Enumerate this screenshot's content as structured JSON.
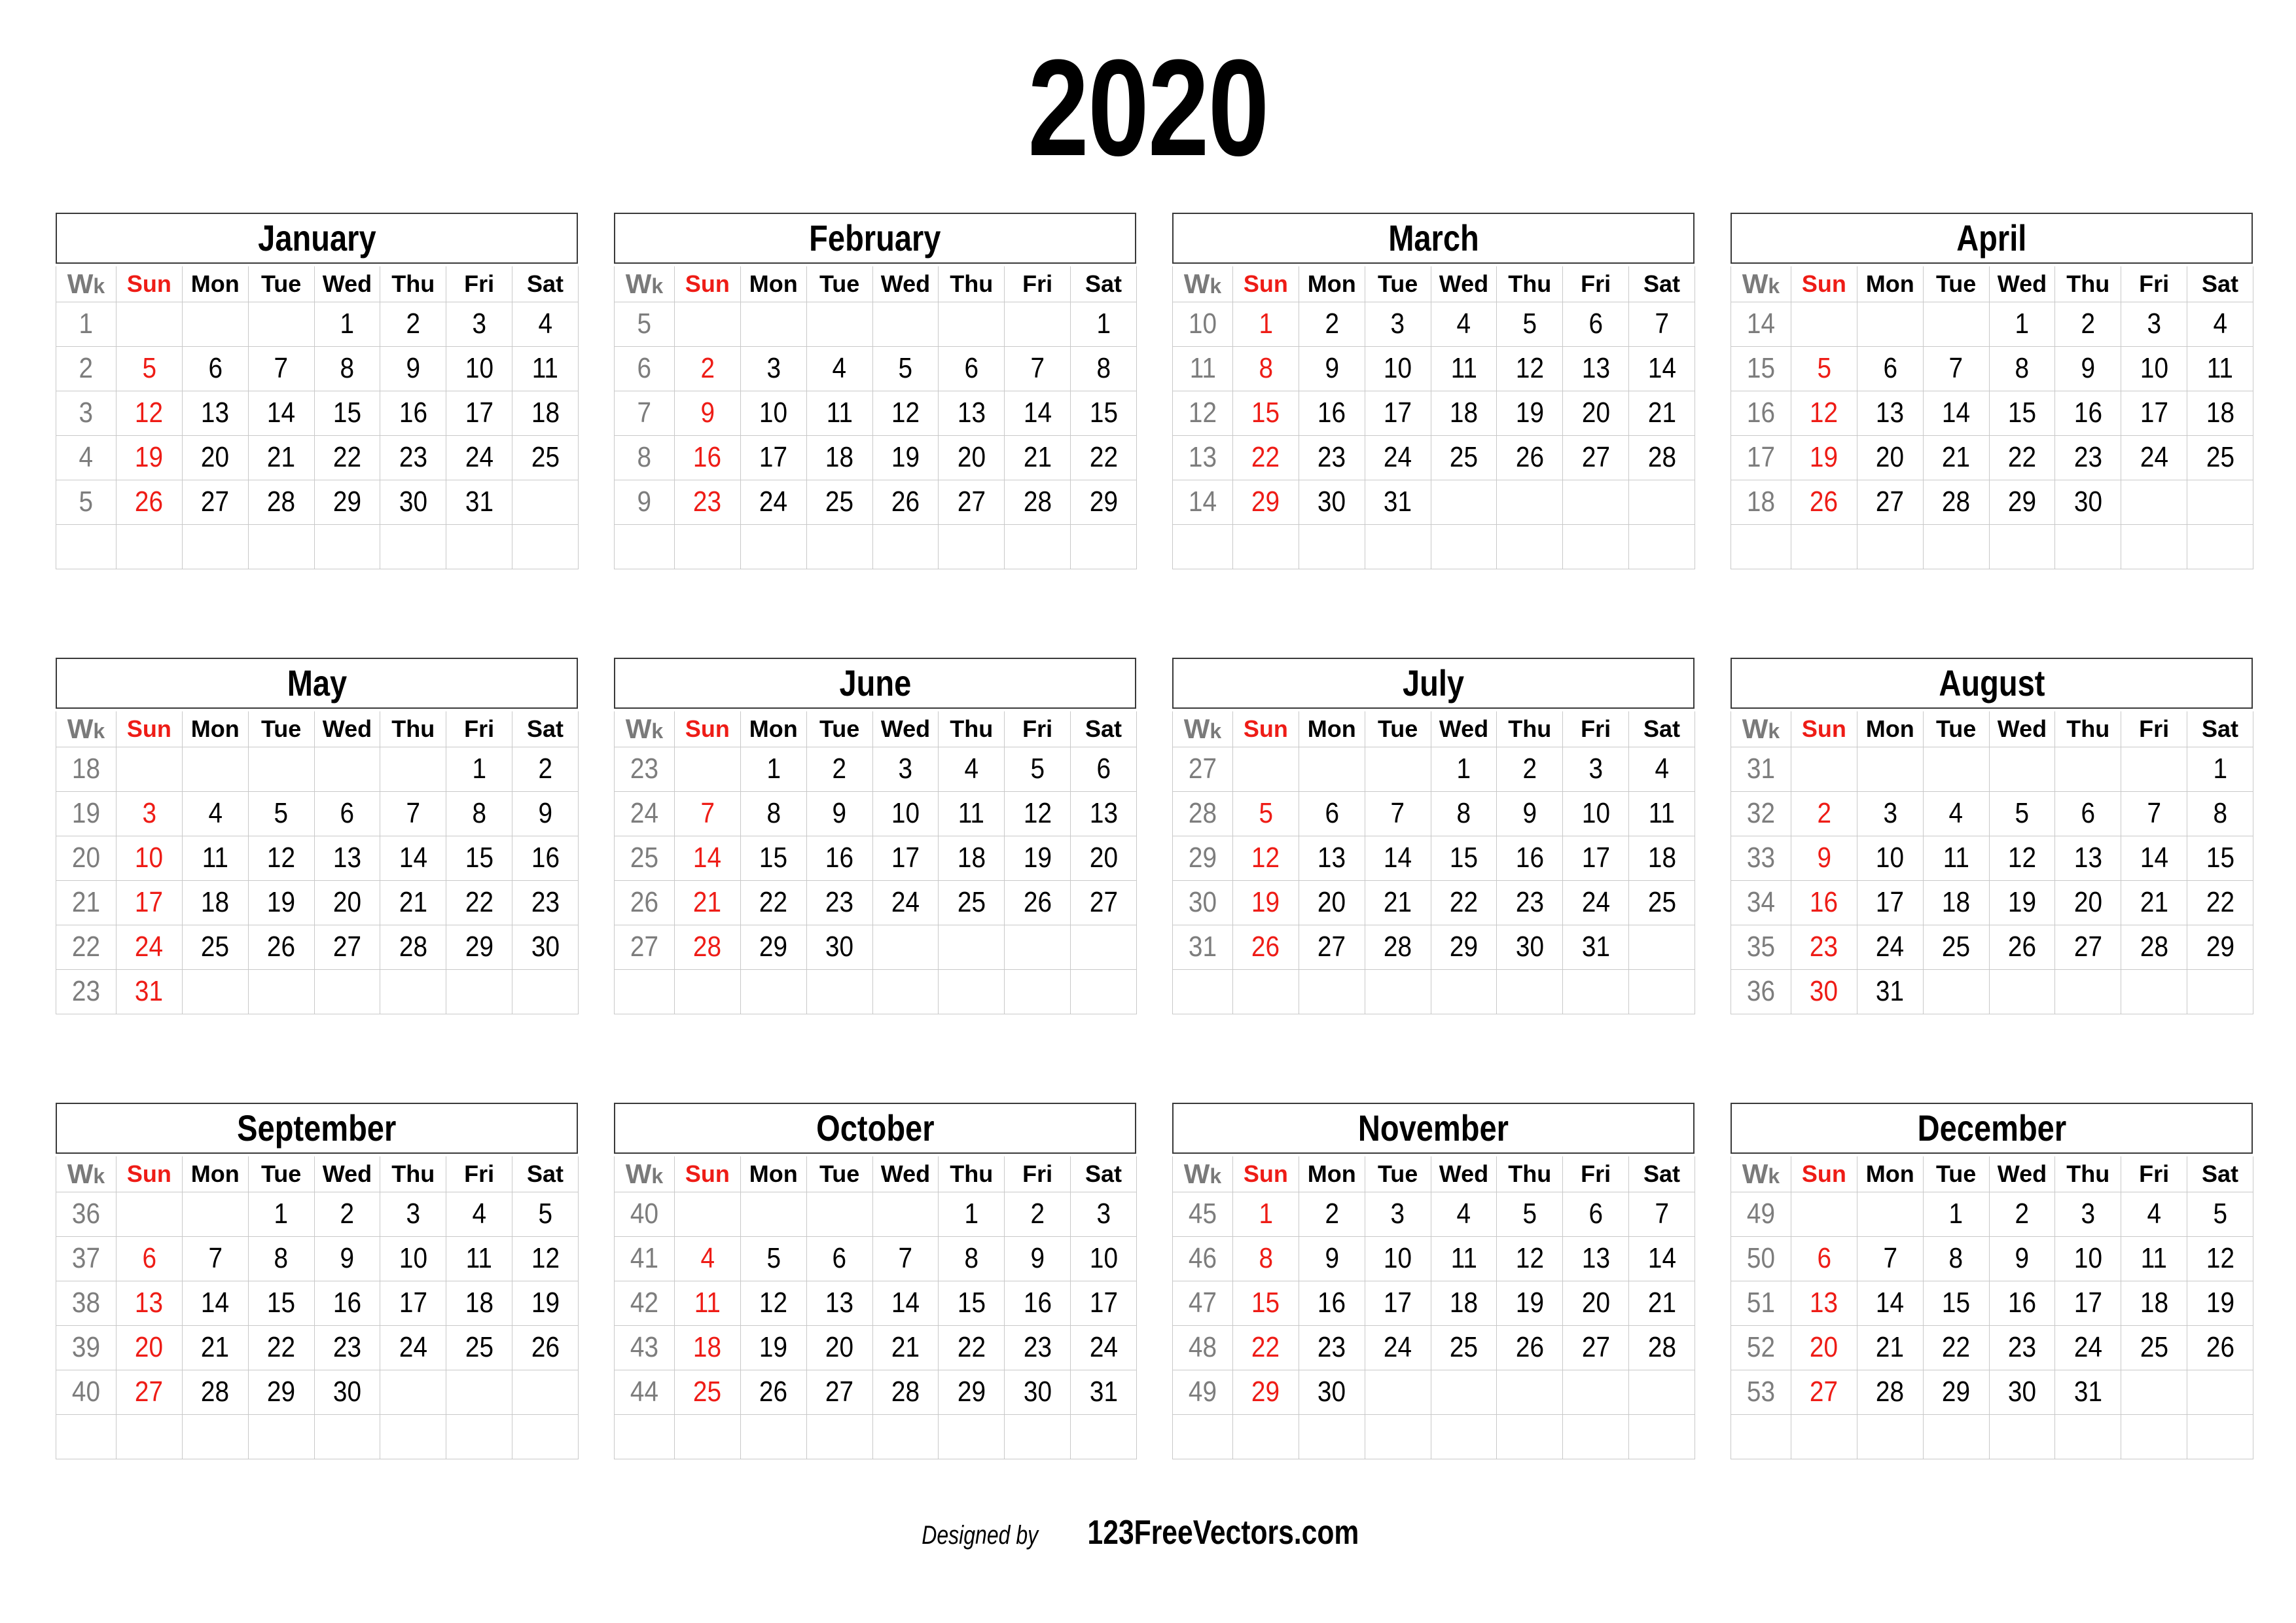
{
  "year_title": "2020",
  "footer": {
    "designed_by": "Designed by",
    "brand": "123FreeVectors.com"
  },
  "colors": {
    "sunday_red": "#ee1c16",
    "week_gray": "#7d7d7d",
    "grid_line": "#c9c9c9",
    "header_border": "#3a3a3a",
    "text_black": "#000000",
    "background": "#ffffff"
  },
  "weekday_headers": {
    "wk_big": "W",
    "wk_small": "k",
    "days": [
      "Sun",
      "Mon",
      "Tue",
      "Wed",
      "Thu",
      "Fri",
      "Sat"
    ]
  },
  "months": [
    {
      "name": "January",
      "weeks": [
        {
          "wk": "1",
          "days": [
            "",
            "",
            "",
            "1",
            "2",
            "3",
            "4"
          ]
        },
        {
          "wk": "2",
          "days": [
            "5",
            "6",
            "7",
            "8",
            "9",
            "10",
            "11"
          ]
        },
        {
          "wk": "3",
          "days": [
            "12",
            "13",
            "14",
            "15",
            "16",
            "17",
            "18"
          ]
        },
        {
          "wk": "4",
          "days": [
            "19",
            "20",
            "21",
            "22",
            "23",
            "24",
            "25"
          ]
        },
        {
          "wk": "5",
          "days": [
            "26",
            "27",
            "28",
            "29",
            "30",
            "31",
            ""
          ]
        },
        {
          "wk": "",
          "days": [
            "",
            "",
            "",
            "",
            "",
            "",
            ""
          ]
        }
      ]
    },
    {
      "name": "February",
      "weeks": [
        {
          "wk": "5",
          "days": [
            "",
            "",
            "",
            "",
            "",
            "",
            "1"
          ]
        },
        {
          "wk": "6",
          "days": [
            "2",
            "3",
            "4",
            "5",
            "6",
            "7",
            "8"
          ]
        },
        {
          "wk": "7",
          "days": [
            "9",
            "10",
            "11",
            "12",
            "13",
            "14",
            "15"
          ]
        },
        {
          "wk": "8",
          "days": [
            "16",
            "17",
            "18",
            "19",
            "20",
            "21",
            "22"
          ]
        },
        {
          "wk": "9",
          "days": [
            "23",
            "24",
            "25",
            "26",
            "27",
            "28",
            "29"
          ]
        },
        {
          "wk": "",
          "days": [
            "",
            "",
            "",
            "",
            "",
            "",
            ""
          ]
        }
      ]
    },
    {
      "name": "March",
      "weeks": [
        {
          "wk": "10",
          "days": [
            "1",
            "2",
            "3",
            "4",
            "5",
            "6",
            "7"
          ]
        },
        {
          "wk": "11",
          "days": [
            "8",
            "9",
            "10",
            "11",
            "12",
            "13",
            "14"
          ]
        },
        {
          "wk": "12",
          "days": [
            "15",
            "16",
            "17",
            "18",
            "19",
            "20",
            "21"
          ]
        },
        {
          "wk": "13",
          "days": [
            "22",
            "23",
            "24",
            "25",
            "26",
            "27",
            "28"
          ]
        },
        {
          "wk": "14",
          "days": [
            "29",
            "30",
            "31",
            "",
            "",
            "",
            ""
          ]
        },
        {
          "wk": "",
          "days": [
            "",
            "",
            "",
            "",
            "",
            "",
            ""
          ]
        }
      ]
    },
    {
      "name": "April",
      "weeks": [
        {
          "wk": "14",
          "days": [
            "",
            "",
            "",
            "1",
            "2",
            "3",
            "4"
          ]
        },
        {
          "wk": "15",
          "days": [
            "5",
            "6",
            "7",
            "8",
            "9",
            "10",
            "11"
          ]
        },
        {
          "wk": "16",
          "days": [
            "12",
            "13",
            "14",
            "15",
            "16",
            "17",
            "18"
          ]
        },
        {
          "wk": "17",
          "days": [
            "19",
            "20",
            "21",
            "22",
            "23",
            "24",
            "25"
          ]
        },
        {
          "wk": "18",
          "days": [
            "26",
            "27",
            "28",
            "29",
            "30",
            "",
            ""
          ]
        },
        {
          "wk": "",
          "days": [
            "",
            "",
            "",
            "",
            "",
            "",
            ""
          ]
        }
      ]
    },
    {
      "name": "May",
      "weeks": [
        {
          "wk": "18",
          "days": [
            "",
            "",
            "",
            "",
            "",
            "1",
            "2"
          ]
        },
        {
          "wk": "19",
          "days": [
            "3",
            "4",
            "5",
            "6",
            "7",
            "8",
            "9"
          ]
        },
        {
          "wk": "20",
          "days": [
            "10",
            "11",
            "12",
            "13",
            "14",
            "15",
            "16"
          ]
        },
        {
          "wk": "21",
          "days": [
            "17",
            "18",
            "19",
            "20",
            "21",
            "22",
            "23"
          ]
        },
        {
          "wk": "22",
          "days": [
            "24",
            "25",
            "26",
            "27",
            "28",
            "29",
            "30"
          ]
        },
        {
          "wk": "23",
          "days": [
            "31",
            "",
            "",
            "",
            "",
            "",
            ""
          ]
        }
      ]
    },
    {
      "name": "June",
      "weeks": [
        {
          "wk": "23",
          "days": [
            "",
            "1",
            "2",
            "3",
            "4",
            "5",
            "6"
          ]
        },
        {
          "wk": "24",
          "days": [
            "7",
            "8",
            "9",
            "10",
            "11",
            "12",
            "13"
          ]
        },
        {
          "wk": "25",
          "days": [
            "14",
            "15",
            "16",
            "17",
            "18",
            "19",
            "20"
          ]
        },
        {
          "wk": "26",
          "days": [
            "21",
            "22",
            "23",
            "24",
            "25",
            "26",
            "27"
          ]
        },
        {
          "wk": "27",
          "days": [
            "28",
            "29",
            "30",
            "",
            "",
            "",
            ""
          ]
        },
        {
          "wk": "",
          "days": [
            "",
            "",
            "",
            "",
            "",
            "",
            ""
          ]
        }
      ]
    },
    {
      "name": "July",
      "weeks": [
        {
          "wk": "27",
          "days": [
            "",
            "",
            "",
            "1",
            "2",
            "3",
            "4"
          ]
        },
        {
          "wk": "28",
          "days": [
            "5",
            "6",
            "7",
            "8",
            "9",
            "10",
            "11"
          ]
        },
        {
          "wk": "29",
          "days": [
            "12",
            "13",
            "14",
            "15",
            "16",
            "17",
            "18"
          ]
        },
        {
          "wk": "30",
          "days": [
            "19",
            "20",
            "21",
            "22",
            "23",
            "24",
            "25"
          ]
        },
        {
          "wk": "31",
          "days": [
            "26",
            "27",
            "28",
            "29",
            "30",
            "31",
            ""
          ]
        },
        {
          "wk": "",
          "days": [
            "",
            "",
            "",
            "",
            "",
            "",
            ""
          ]
        }
      ]
    },
    {
      "name": "August",
      "weeks": [
        {
          "wk": "31",
          "days": [
            "",
            "",
            "",
            "",
            "",
            "",
            "1"
          ]
        },
        {
          "wk": "32",
          "days": [
            "2",
            "3",
            "4",
            "5",
            "6",
            "7",
            "8"
          ]
        },
        {
          "wk": "33",
          "days": [
            "9",
            "10",
            "11",
            "12",
            "13",
            "14",
            "15"
          ]
        },
        {
          "wk": "34",
          "days": [
            "16",
            "17",
            "18",
            "19",
            "20",
            "21",
            "22"
          ]
        },
        {
          "wk": "35",
          "days": [
            "23",
            "24",
            "25",
            "26",
            "27",
            "28",
            "29"
          ]
        },
        {
          "wk": "36",
          "days": [
            "30",
            "31",
            "",
            "",
            "",
            "",
            ""
          ]
        }
      ]
    },
    {
      "name": "September",
      "weeks": [
        {
          "wk": "36",
          "days": [
            "",
            "",
            "1",
            "2",
            "3",
            "4",
            "5"
          ]
        },
        {
          "wk": "37",
          "days": [
            "6",
            "7",
            "8",
            "9",
            "10",
            "11",
            "12"
          ]
        },
        {
          "wk": "38",
          "days": [
            "13",
            "14",
            "15",
            "16",
            "17",
            "18",
            "19"
          ]
        },
        {
          "wk": "39",
          "days": [
            "20",
            "21",
            "22",
            "23",
            "24",
            "25",
            "26"
          ]
        },
        {
          "wk": "40",
          "days": [
            "27",
            "28",
            "29",
            "30",
            "",
            "",
            ""
          ]
        },
        {
          "wk": "",
          "days": [
            "",
            "",
            "",
            "",
            "",
            "",
            ""
          ]
        }
      ]
    },
    {
      "name": "October",
      "weeks": [
        {
          "wk": "40",
          "days": [
            "",
            "",
            "",
            "",
            "1",
            "2",
            "3"
          ]
        },
        {
          "wk": "41",
          "days": [
            "4",
            "5",
            "6",
            "7",
            "8",
            "9",
            "10"
          ]
        },
        {
          "wk": "42",
          "days": [
            "11",
            "12",
            "13",
            "14",
            "15",
            "16",
            "17"
          ]
        },
        {
          "wk": "43",
          "days": [
            "18",
            "19",
            "20",
            "21",
            "22",
            "23",
            "24"
          ]
        },
        {
          "wk": "44",
          "days": [
            "25",
            "26",
            "27",
            "28",
            "29",
            "30",
            "31"
          ]
        },
        {
          "wk": "",
          "days": [
            "",
            "",
            "",
            "",
            "",
            "",
            ""
          ]
        }
      ]
    },
    {
      "name": "November",
      "weeks": [
        {
          "wk": "45",
          "days": [
            "1",
            "2",
            "3",
            "4",
            "5",
            "6",
            "7"
          ]
        },
        {
          "wk": "46",
          "days": [
            "8",
            "9",
            "10",
            "11",
            "12",
            "13",
            "14"
          ]
        },
        {
          "wk": "47",
          "days": [
            "15",
            "16",
            "17",
            "18",
            "19",
            "20",
            "21"
          ]
        },
        {
          "wk": "48",
          "days": [
            "22",
            "23",
            "24",
            "25",
            "26",
            "27",
            "28"
          ]
        },
        {
          "wk": "49",
          "days": [
            "29",
            "30",
            "",
            "",
            "",
            "",
            ""
          ]
        },
        {
          "wk": "",
          "days": [
            "",
            "",
            "",
            "",
            "",
            "",
            ""
          ]
        }
      ]
    },
    {
      "name": "December",
      "weeks": [
        {
          "wk": "49",
          "days": [
            "",
            "",
            "1",
            "2",
            "3",
            "4",
            "5"
          ]
        },
        {
          "wk": "50",
          "days": [
            "6",
            "7",
            "8",
            "9",
            "10",
            "11",
            "12"
          ]
        },
        {
          "wk": "51",
          "days": [
            "13",
            "14",
            "15",
            "16",
            "17",
            "18",
            "19"
          ]
        },
        {
          "wk": "52",
          "days": [
            "20",
            "21",
            "22",
            "23",
            "24",
            "25",
            "26"
          ]
        },
        {
          "wk": "53",
          "days": [
            "27",
            "28",
            "29",
            "30",
            "31",
            "",
            ""
          ]
        },
        {
          "wk": "",
          "days": [
            "",
            "",
            "",
            "",
            "",
            "",
            ""
          ]
        }
      ]
    }
  ]
}
